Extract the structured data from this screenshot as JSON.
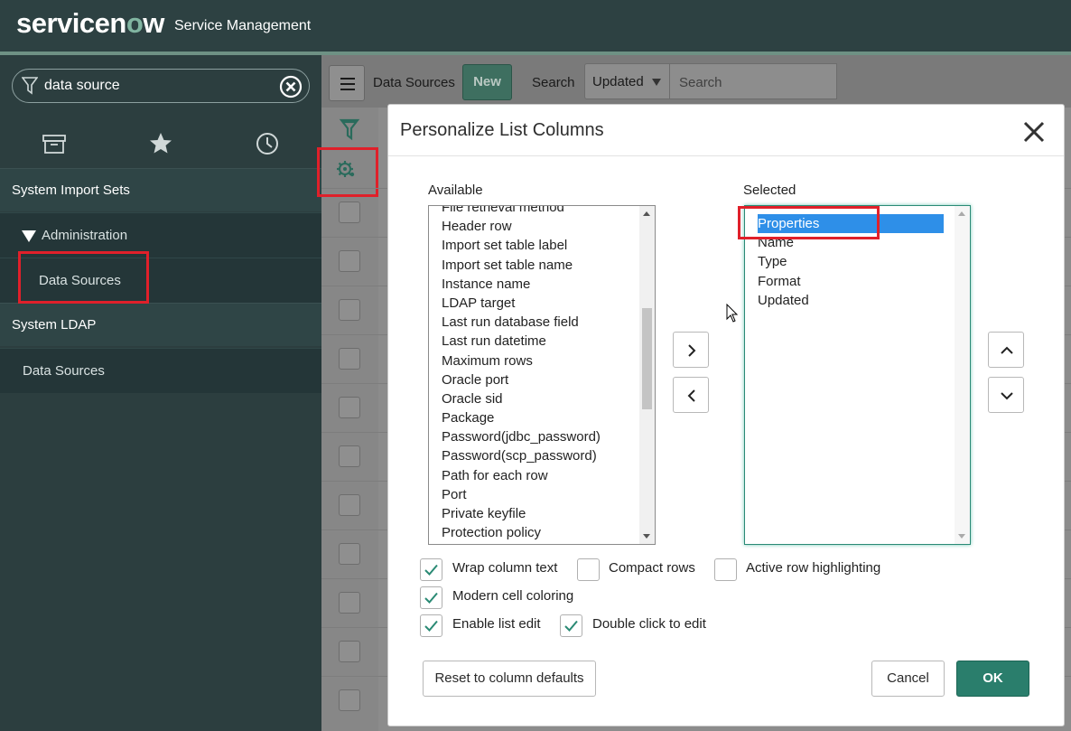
{
  "header": {
    "logo_text_pre": "servicen",
    "logo_text_o": "o",
    "logo_text_post": "w",
    "app_name": "Service Management"
  },
  "nav": {
    "filter_value": "data source",
    "sections": [
      {
        "label": "System Import Sets"
      },
      {
        "label": "System LDAP"
      }
    ],
    "import_sets_group": "Administration",
    "import_sets_item": "Data Sources",
    "ldap_item": "Data Sources"
  },
  "list": {
    "title": "Data Sources",
    "new_label": "New",
    "search_label": "Search",
    "search_field": "Updated",
    "search_placeholder": "Search"
  },
  "modal": {
    "title": "Personalize List Columns",
    "available_label": "Available",
    "selected_label": "Selected",
    "available_items": [
      "File retrieval method",
      "Header row",
      "Import set table label",
      "Import set table name",
      "Instance name",
      "LDAP target",
      "Last run database field",
      "Last run datetime",
      "Maximum rows",
      "Oracle port",
      "Oracle sid",
      "Package",
      "Password(jdbc_password)",
      "Password(scp_password)",
      "Path for each row",
      "Port",
      "Private keyfile",
      "Protection policy"
    ],
    "selected_items": [
      "Properties",
      "Name",
      "Type",
      "Format",
      "Updated"
    ],
    "options": {
      "wrap_column_text": {
        "label": "Wrap column text",
        "checked": true
      },
      "compact_rows": {
        "label": "Compact rows",
        "checked": false
      },
      "active_row_highlighting": {
        "label": "Active row highlighting",
        "checked": false
      },
      "modern_cell_coloring": {
        "label": "Modern cell coloring",
        "checked": true
      },
      "enable_list_edit": {
        "label": "Enable list edit",
        "checked": true
      },
      "double_click_to_edit": {
        "label": "Double click to edit",
        "checked": true
      }
    },
    "reset_label": "Reset to column defaults",
    "cancel_label": "Cancel",
    "ok_label": "OK"
  },
  "colors": {
    "header_bg": "#2d4142",
    "nav_bg": "#2c3e3f",
    "accent_green": "#2a7e6c",
    "highlight_red": "#e0202a",
    "selection_blue": "#2e8fe8"
  }
}
